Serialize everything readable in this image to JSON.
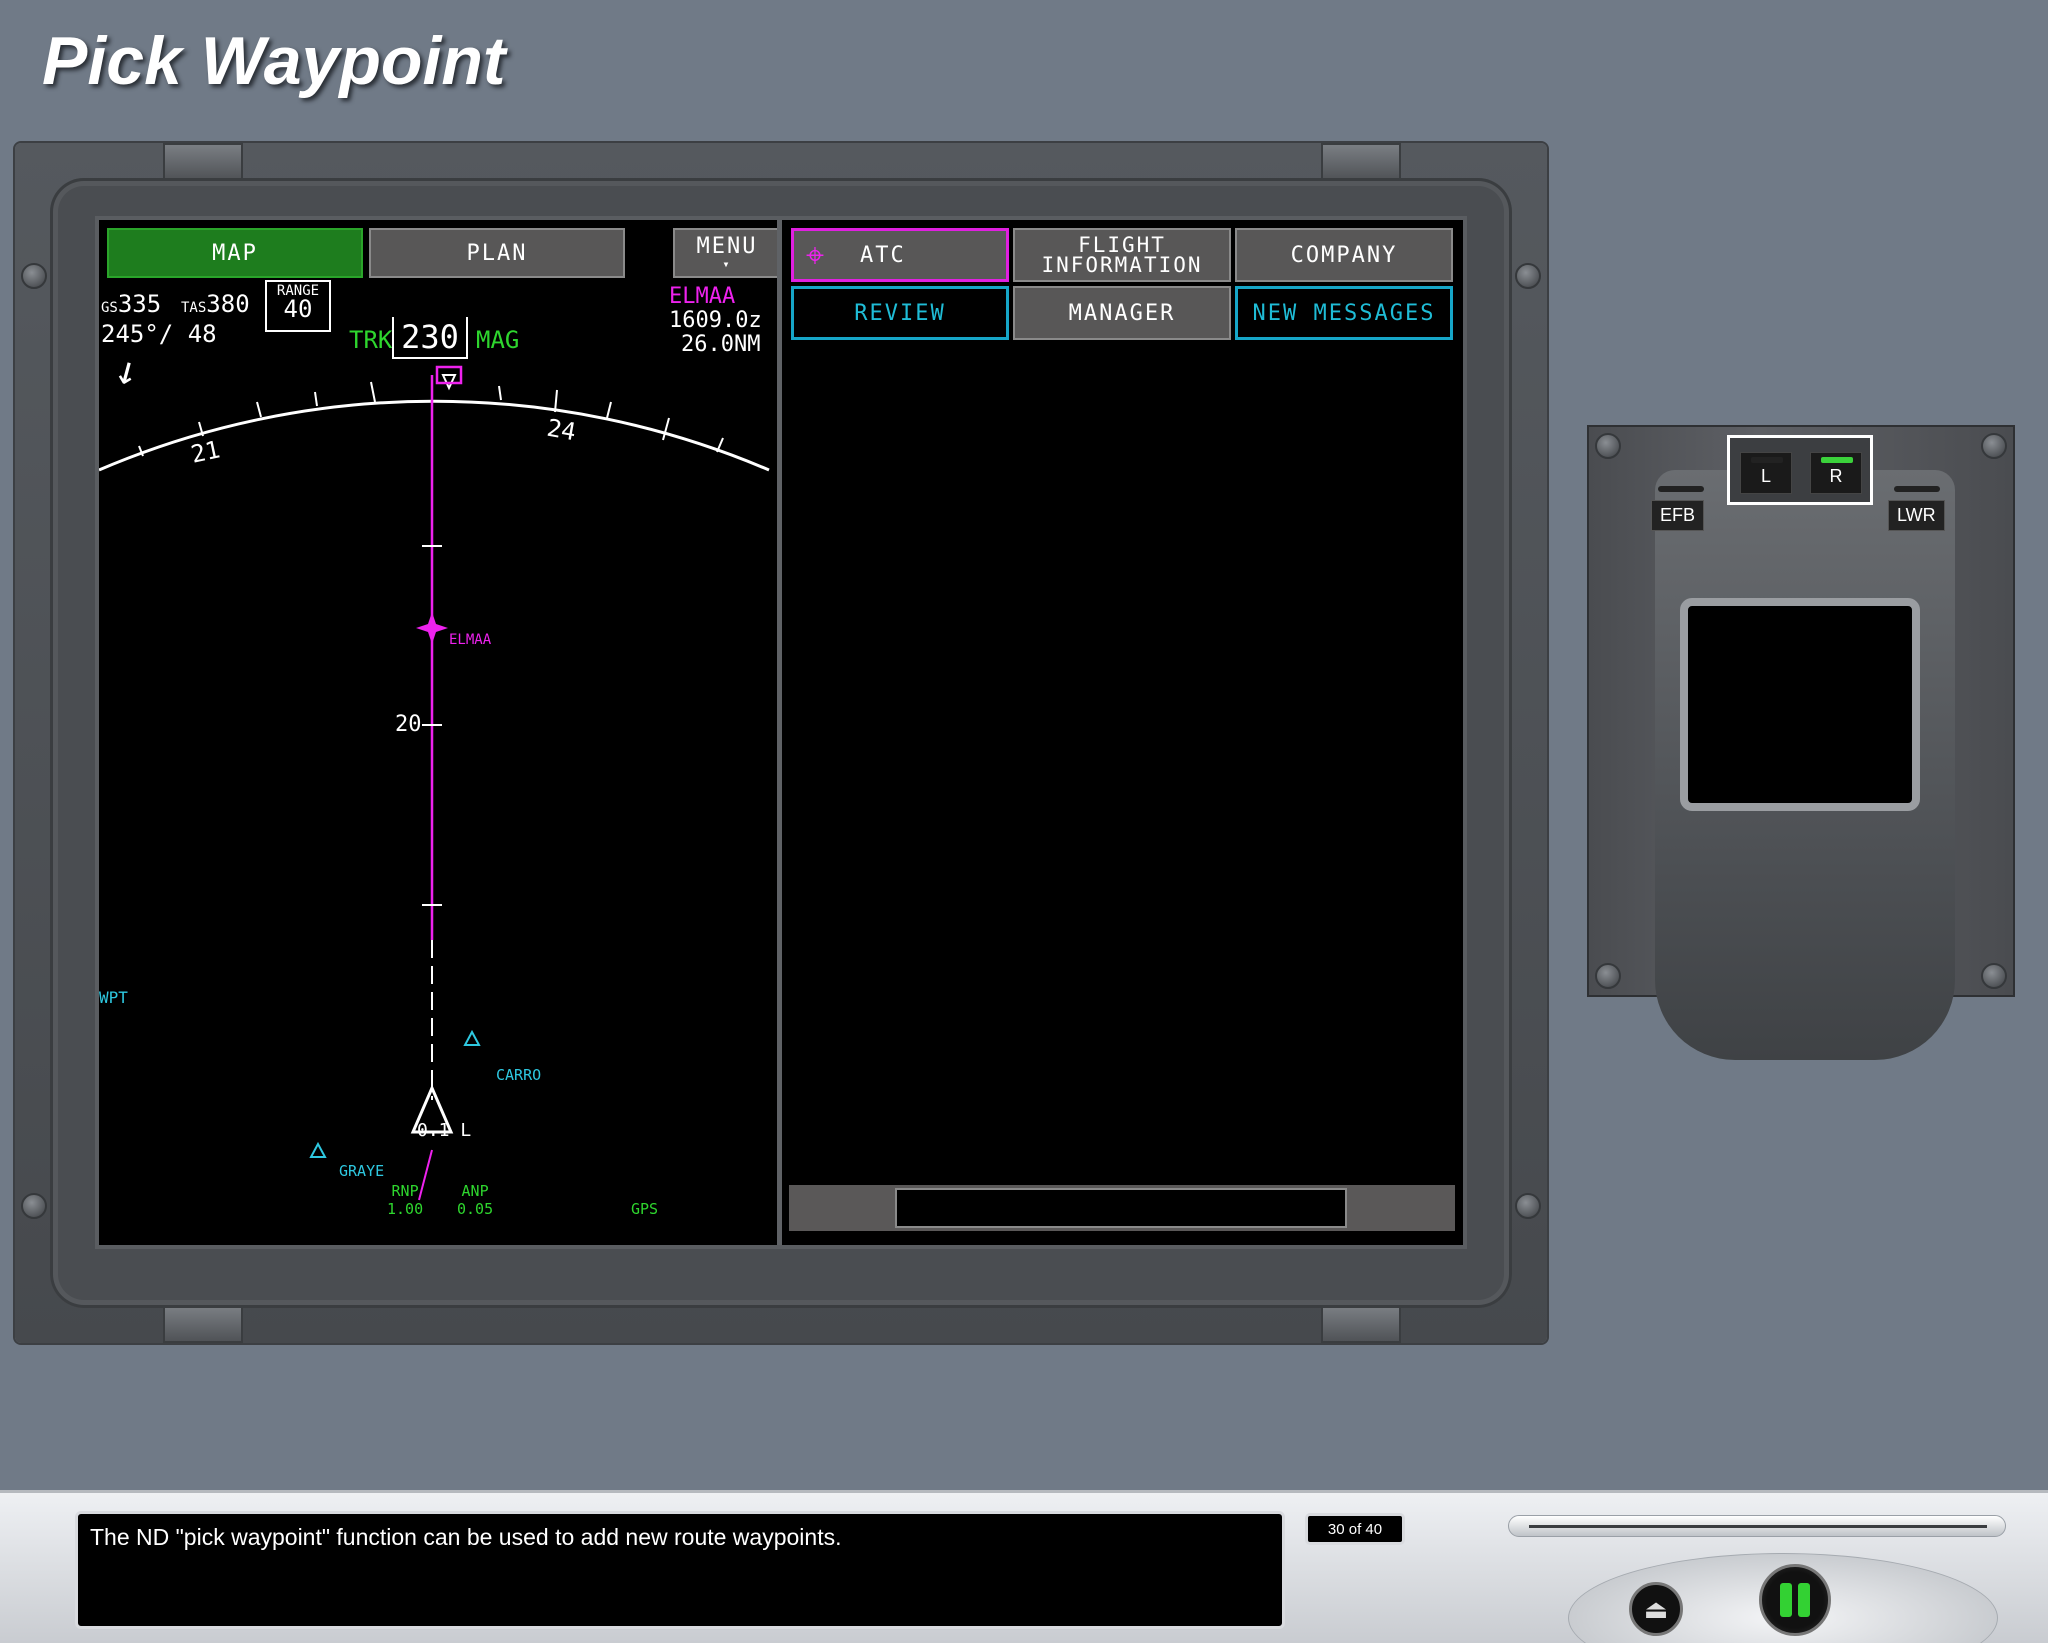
{
  "page": {
    "title": "Pick Waypoint"
  },
  "nd": {
    "tabs": {
      "map": "MAP",
      "plan": "PLAN",
      "menu": "MENU"
    },
    "gs_label": "GS",
    "gs_value": "335",
    "tas_label": "TAS",
    "tas_value": "380",
    "wind": "245°/ 48",
    "range_label": "RANGE",
    "range_value": "40",
    "trk_label": "TRK",
    "heading": "230",
    "mag_label": "MAG",
    "active_wpt": "ELMAA",
    "eta": "1609.0z",
    "dist": "26.0NM",
    "compass": {
      "left": "21",
      "right": "24"
    },
    "route_wpt": "ELMAA",
    "range_mark": "20",
    "wpt_label": "WPT",
    "waypoints": [
      "CARRO",
      "GRAYE"
    ],
    "xtk": "0.1 L",
    "rnp_label": "RNP",
    "rnp_value": "1.00",
    "anp_label": "ANP",
    "anp_value": "0.05",
    "gps": "GPS"
  },
  "dcm": {
    "atc": "ATC",
    "flight_info_1": "FLIGHT",
    "flight_info_2": "INFORMATION",
    "company": "COMPANY",
    "review": "REVIEW",
    "manager": "MANAGER",
    "new_messages": "NEW MESSAGES"
  },
  "panel": {
    "efb": "EFB",
    "lwr": "LWR",
    "left": "L",
    "right": "R"
  },
  "footer": {
    "caption": "The ND \"pick waypoint\" function can be used to add new route waypoints.",
    "counter": "30 of 40"
  }
}
